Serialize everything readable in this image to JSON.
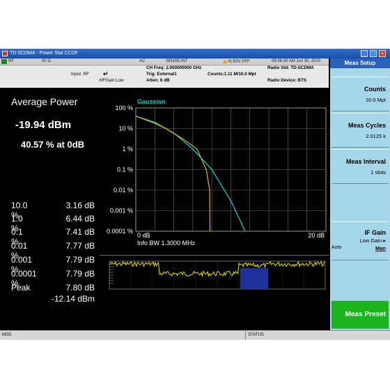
{
  "window": {
    "title": "TD SCDMA - Power Stat CCDF"
  },
  "settings": {
    "status_items": [
      "RF",
      "50 Ω",
      "AC",
      "SENSE:INT",
      "ALIGN OFF",
      "09:36:30 AM Jun 30, 2010"
    ],
    "input": "Input: RF",
    "if_gain": "#IFGain:Low",
    "ch_freq": "CH Freq: 2.000000000 GHz",
    "trig": "Trig: External1",
    "atten": "Atten: 6 dB",
    "counts": "Counts:1.11 M/10.0 Mpt",
    "radio_std": "Radio Std: TD-SCDMA",
    "radio_device": "Radio Device: BTS"
  },
  "summary": {
    "avg_label": "Average Power",
    "avg_value": "-19.94 dBm",
    "pct_at_0db": "40.57 % at 0dB",
    "rows": [
      {
        "label": "10.0 %",
        "value": "3.16 dB"
      },
      {
        "label": "1.0 %",
        "value": "6.44 dB"
      },
      {
        "label": "0.1 %",
        "value": "7.41 dB"
      },
      {
        "label": "0.01 %",
        "value": "7.77 dB"
      },
      {
        "label": "0.001 %",
        "value": "7.79 dB"
      },
      {
        "label": "0.0001 %",
        "value": "7.79 dB"
      }
    ],
    "peak_label": "Peak",
    "peak_db": "7.80 dB",
    "peak_dbm": "-12.14 dBm"
  },
  "chart_data": {
    "type": "line",
    "series": [
      {
        "name": "Gaussian",
        "color": "#29c4c4",
        "x": [
          0,
          2,
          4,
          6,
          8,
          10,
          11.5
        ],
        "y": [
          40,
          20,
          6,
          1,
          0.1,
          0.003,
          0.0001
        ]
      },
      {
        "color": "#c8b428",
        "x": [
          0,
          2,
          3.16,
          5,
          6.44,
          7.41,
          7.77,
          7.79,
          7.8,
          7.8
        ],
        "y": [
          40,
          18,
          10,
          3,
          1,
          0.1,
          0.01,
          0.001,
          0.0003,
          0.0001
        ]
      }
    ],
    "legend": "Gaussian",
    "yticks": [
      "100 %",
      "10 %",
      "1 %",
      "0.1 %",
      "0.01 %",
      "0.001 %",
      "0.0001 %"
    ],
    "xtick_left": "0 dB",
    "xtick_right": "20 dB",
    "xlabel": "Info BW 1.3000 MHz",
    "xlim": [
      0,
      20
    ],
    "ylim_log": [
      0.0001,
      100
    ],
    "grid": true
  },
  "softkeys": {
    "header": "Meas Setup",
    "counts_label": "Counts",
    "counts_value": "10.0 Mpt",
    "cycles_label": "Meas Cycles",
    "cycles_value": "2.0125 k",
    "interval_label": "Meas Interval",
    "interval_value": "1 slots",
    "ifgain_label": "IF Gain",
    "ifgain_sub": "Low Gain ▸",
    "ifgain_auto": "Auto",
    "ifgain_man": "Man",
    "preset_label": "Meas Preset"
  },
  "statusbar": {
    "msg": "MSG",
    "status": "STATUS"
  },
  "colors": {
    "gaussian": "#29c4c4",
    "measured": "#c8b428",
    "time_trace": "#e8e000",
    "time_fill": "#1f2f9c"
  }
}
